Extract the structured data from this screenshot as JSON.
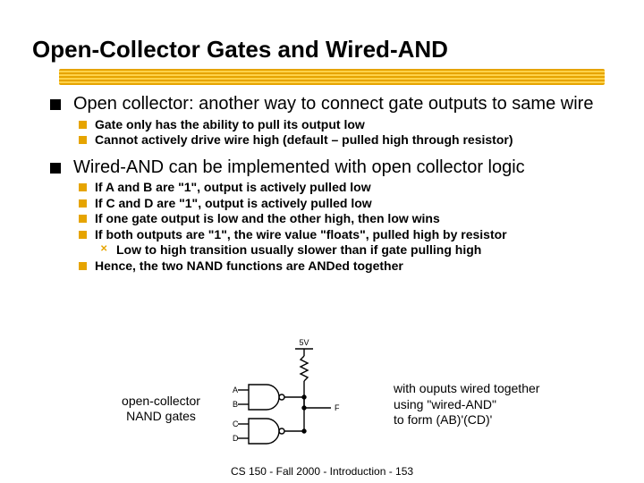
{
  "title": "Open-Collector Gates and Wired-AND",
  "footer": "CS 150 - Fall 2000 - Introduction - 153",
  "bullets": {
    "b1": "Open collector: another way to connect gate outputs to same wire",
    "b1a": "Gate only has the ability to pull its output low",
    "b1b": "Cannot actively drive wire high (default – pulled high through resistor)",
    "b2": "Wired-AND can be implemented with open collector logic",
    "b2a": "If A and B are \"1\", output is actively pulled low",
    "b2b": "If C and D are \"1\", output is actively pulled low",
    "b2c": "If one gate output is low and the other high, then low wins",
    "b2d": "If both outputs are \"1\", the wire value \"floats\", pulled high by resistor",
    "b2d1": "Low to high transition usually slower than if gate pulling high",
    "b2e": "Hence, the two NAND functions are ANDed together"
  },
  "figure": {
    "left_label_l1": "open-collector",
    "left_label_l2": "NAND gates",
    "right_label_l1": "with ouputs wired together",
    "right_label_l2": "using \"wired-AND\"",
    "right_label_l3": "to form (AB)'(CD)'",
    "pins": {
      "A": "A",
      "B": "B",
      "C": "C",
      "D": "D",
      "F": "F"
    },
    "Vcc": "5V"
  }
}
